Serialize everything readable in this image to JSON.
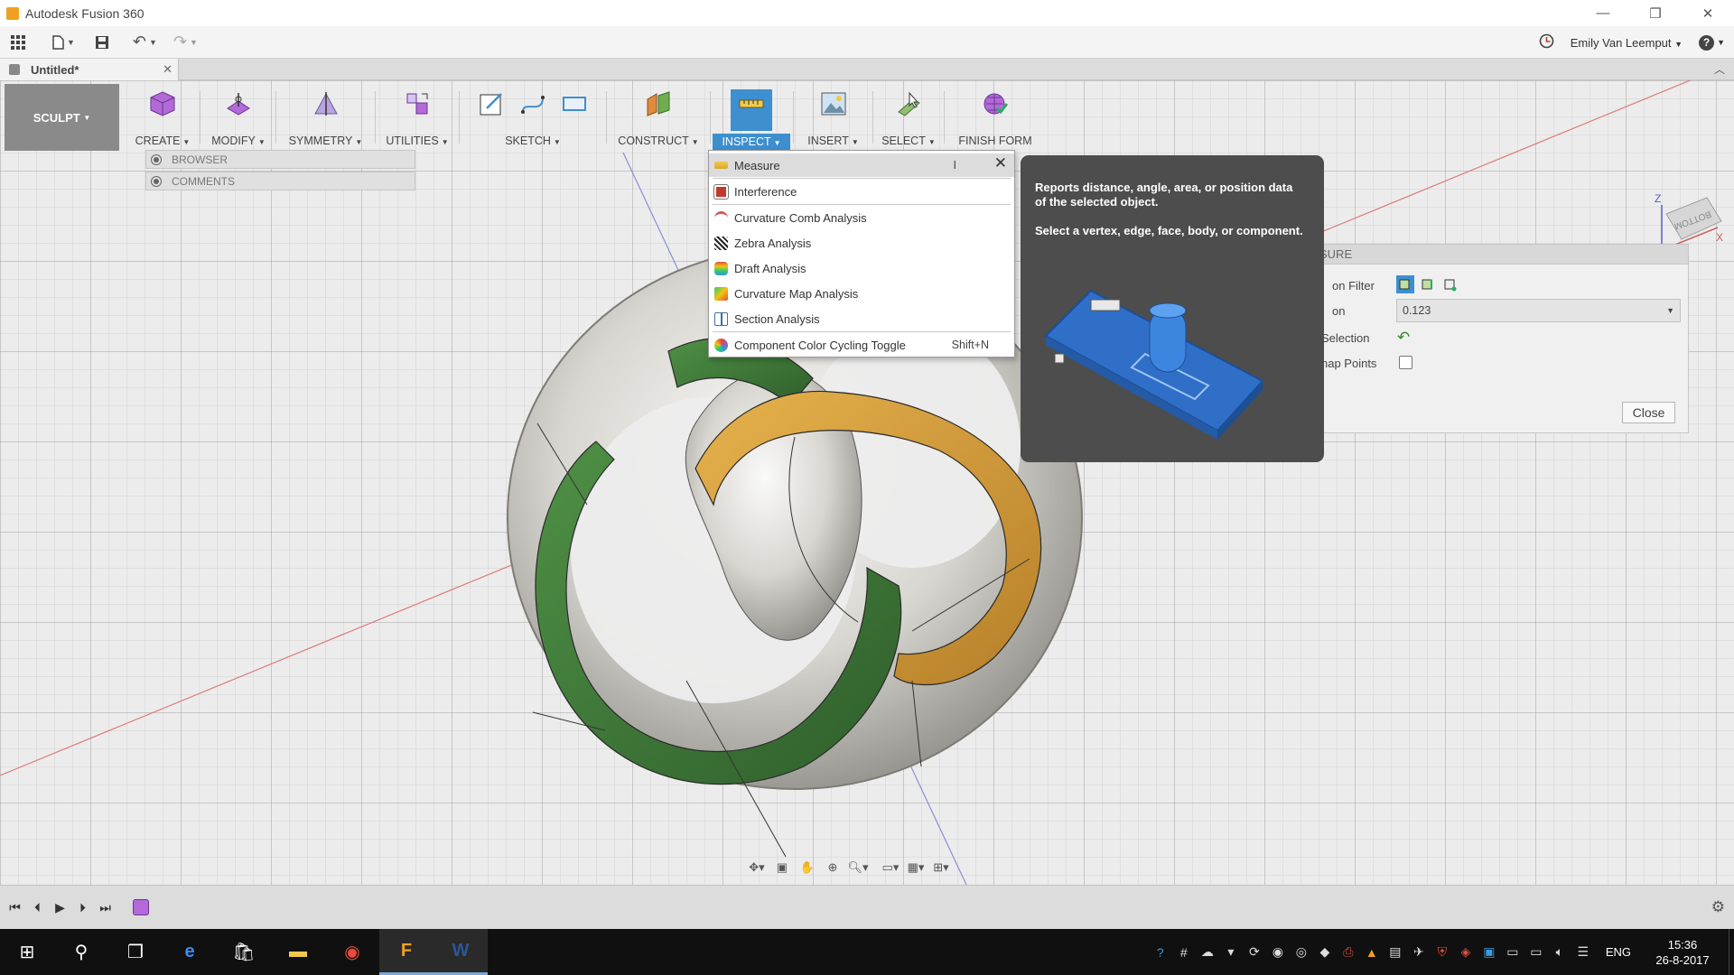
{
  "window": {
    "title": "Autodesk Fusion 360",
    "minimize_glyph": "—",
    "restore_glyph": "❐",
    "close_glyph": "✕"
  },
  "quick_access": {
    "user_name": "Emily Van Leemput",
    "help_glyph": "?"
  },
  "document_tab": {
    "name": "Untitled*",
    "close_glyph": "✕"
  },
  "ribbon": {
    "workspace": "SCULPT",
    "groups": [
      {
        "label": "CREATE"
      },
      {
        "label": "MODIFY"
      },
      {
        "label": "SYMMETRY"
      },
      {
        "label": "UTILITIES"
      },
      {
        "label": "SKETCH"
      },
      {
        "label": "CONSTRUCT"
      },
      {
        "label": "INSPECT"
      },
      {
        "label": "INSERT"
      },
      {
        "label": "SELECT"
      },
      {
        "label": "FINISH FORM"
      }
    ]
  },
  "side_panels": {
    "browser": "BROWSER",
    "comments": "COMMENTS"
  },
  "inspect_menu": {
    "items": [
      {
        "label": "Measure",
        "shortcut": "I"
      },
      {
        "label": "Interference",
        "shortcut": ""
      },
      {
        "label": "Curvature Comb Analysis",
        "shortcut": ""
      },
      {
        "label": "Zebra Analysis",
        "shortcut": ""
      },
      {
        "label": "Draft Analysis",
        "shortcut": ""
      },
      {
        "label": "Curvature Map Analysis",
        "shortcut": ""
      },
      {
        "label": "Section Analysis",
        "shortcut": ""
      },
      {
        "label": "Component Color Cycling Toggle",
        "shortcut": "Shift+N"
      }
    ],
    "close_glyph": "✕"
  },
  "tooltip": {
    "line1": "Reports distance, angle, area, or position data of the selected object.",
    "line2": "Select a vertex, edge, face, body, or component."
  },
  "measure_dialog": {
    "header": "SURE",
    "selection_filter_label": "on Filter",
    "precision_label": "on",
    "precision_value": "0.123",
    "selection_label": "Selection",
    "snap_points_label": "nap Points",
    "close_label": "Close"
  },
  "viewcube": {
    "face": "BOTTOM",
    "axis_z": "Z",
    "axis_x": "X"
  },
  "taskbar": {
    "language": "ENG",
    "time": "15:36",
    "date": "26-8-2017"
  },
  "colors": {
    "accent": "#3d8fd0",
    "ribbon_bg": "#f4f4f4",
    "workspace_bg": "#8a8a8a",
    "green_band": "#3f7a3a",
    "orange_band": "#d9a23c",
    "taskbar": "#101010"
  }
}
